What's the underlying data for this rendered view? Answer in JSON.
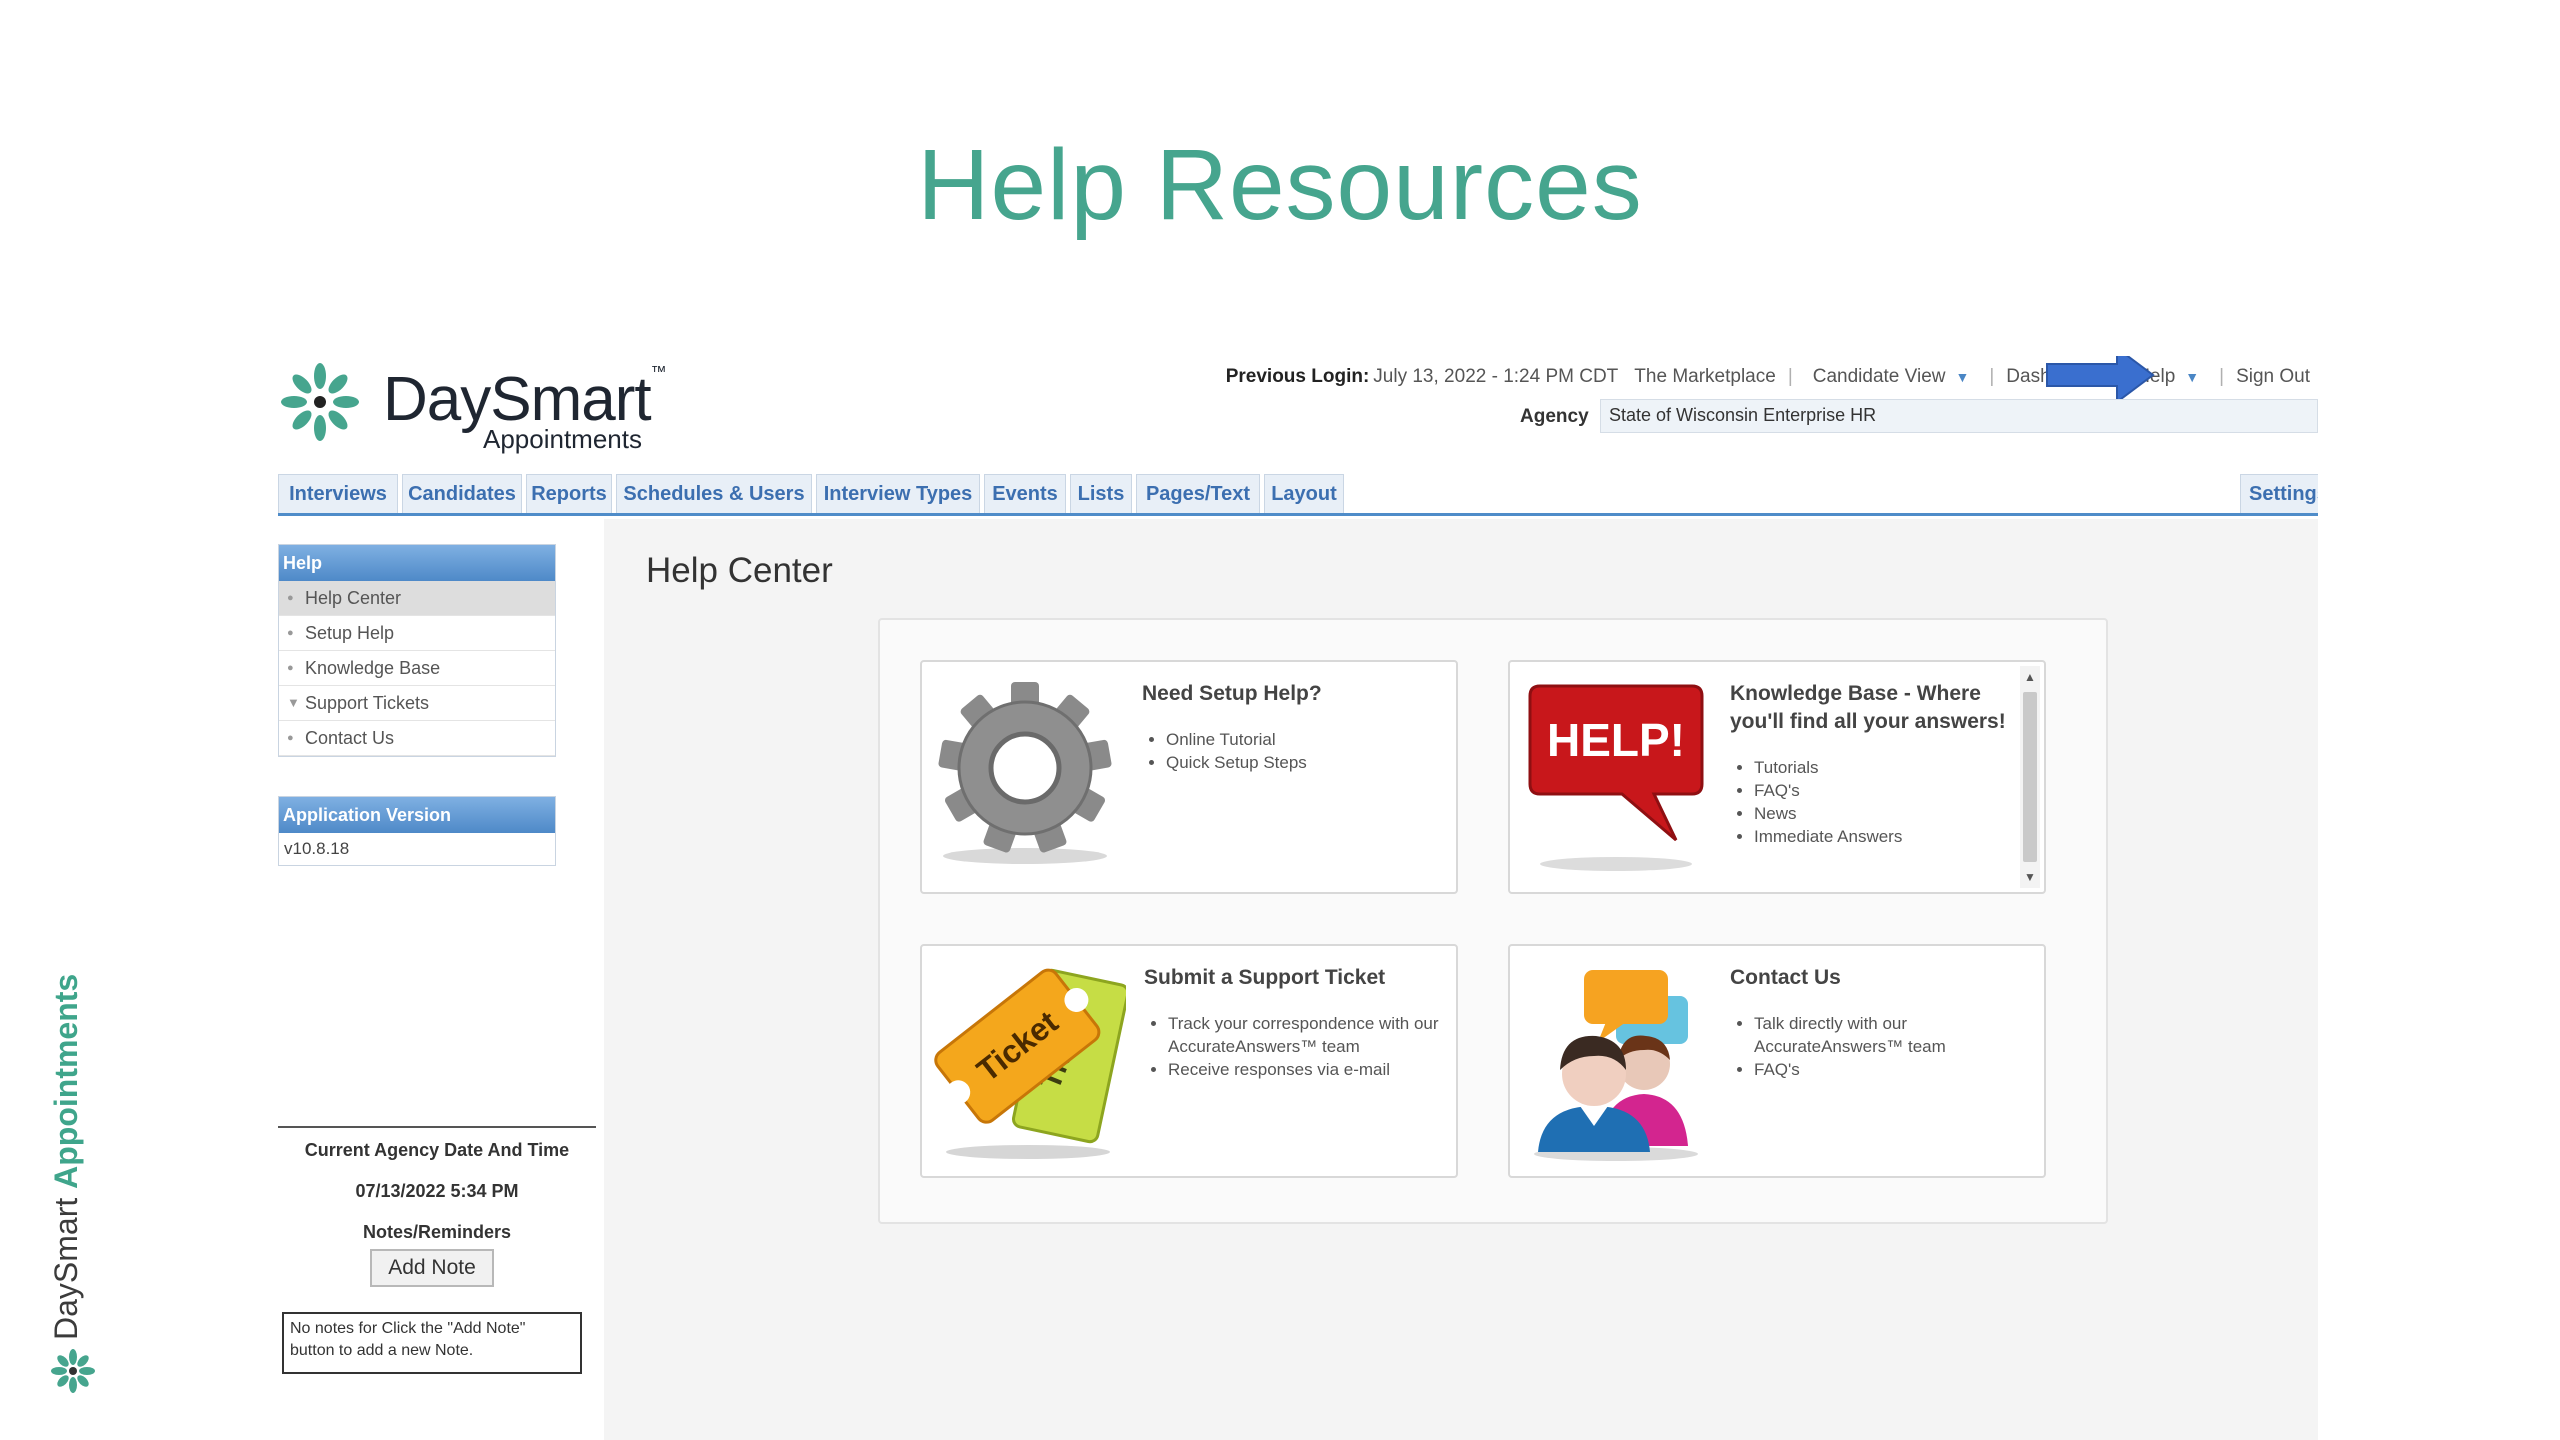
{
  "slide": {
    "title": "Help Resources",
    "side_brand": {
      "part1": "DaySmart ",
      "part2": "Appointments"
    }
  },
  "app": {
    "logo": {
      "name": "DaySmart",
      "trademark": "™",
      "sub": "Appointments"
    },
    "topbar": {
      "previous_login_label": "Previous Login:",
      "previous_login_value": "July 13, 2022 - 1:24 PM CDT",
      "links": [
        "The Marketplace",
        "Candidate View",
        "Dashboard",
        "Help",
        "Sign Out"
      ],
      "agency_label": "Agency",
      "agency_value": "State of Wisconsin Enterprise HR"
    },
    "nav": {
      "tabs": [
        "Interviews",
        "Candidates",
        "Reports",
        "Schedules & Users",
        "Interview Types",
        "Events",
        "Lists",
        "Pages/Text",
        "Layout"
      ],
      "settings": "Settings"
    },
    "sidebar": {
      "help_header": "Help",
      "help_items": [
        "Help Center",
        "Setup Help",
        "Knowledge Base",
        "Support Tickets",
        "Contact Us"
      ],
      "version_header": "Application Version",
      "version": "v10.8.18",
      "date_label": "Current Agency Date And Time",
      "date_value": "07/13/2022 5:34 PM",
      "notes_label": "Notes/Reminders",
      "add_note": "Add Note",
      "note_text": "No notes for Click the \"Add Note\" button to add a new Note."
    },
    "help_center": {
      "title": "Help Center",
      "cards": [
        {
          "title": "Need Setup Help?",
          "items": [
            "Online Tutorial",
            "Quick Setup Steps"
          ]
        },
        {
          "title": "Knowledge Base - Where you'll find all your answers!",
          "items": [
            "Tutorials",
            "FAQ's",
            "News",
            "Immediate Answers"
          ],
          "art_text": "HELP!"
        },
        {
          "title": "Submit a Support Ticket",
          "items": [
            "Track your correspondence with our AccurateAnswers™ team",
            "Receive responses via e-mail"
          ],
          "art_text": "Ticket",
          "art_text2": "Tick"
        },
        {
          "title": "Contact Us",
          "items": [
            "Talk directly with our AccurateAnswers™ team",
            "FAQ's"
          ]
        }
      ]
    }
  },
  "colors": {
    "accent_green": "#46a58e",
    "nav_blue": "#4f8cc9",
    "help_red": "#c8171b",
    "arrow_blue": "#3a6fcf"
  }
}
